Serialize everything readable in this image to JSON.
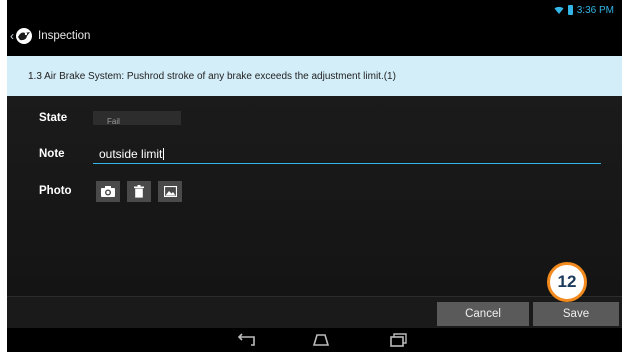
{
  "status_bar": {
    "time": "3:36 PM",
    "icons": [
      "wifi-icon",
      "battery-icon"
    ],
    "accent": "#33b5e5"
  },
  "action_bar": {
    "title": "Inspection",
    "up_glyph": "‹"
  },
  "banner": {
    "text": "1.3 Air Brake System: Pushrod stroke of any brake exceeds the adjustment limit.(1)",
    "color": "#d4eef9"
  },
  "form": {
    "state_label": "State",
    "state_value": "Fail",
    "note_label": "Note",
    "note_value": "outside limit",
    "photo_label": "Photo",
    "photo_buttons": [
      "camera-icon",
      "trash-icon",
      "gallery-icon"
    ]
  },
  "buttons": {
    "cancel": "Cancel",
    "save": "Save"
  },
  "nav": [
    "back-icon",
    "home-icon",
    "recent-apps-icon"
  ],
  "annotation": {
    "step": "12",
    "color": "#f28a1e"
  }
}
